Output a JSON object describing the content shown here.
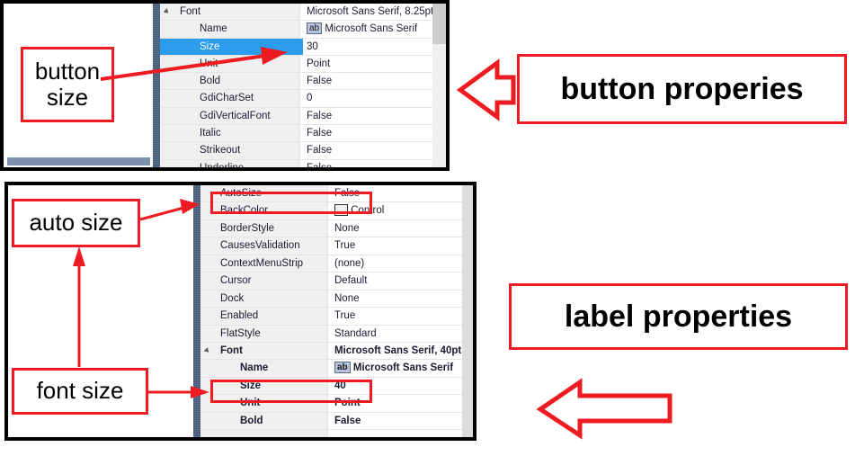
{
  "top_panel": {
    "grid_rows": [
      {
        "name": "Font",
        "value": "Microsoft Sans Serif, 8.25pt",
        "indent": 0,
        "expander": true,
        "selected": false,
        "bold": false,
        "chip": null
      },
      {
        "name": "Name",
        "value": "Microsoft Sans Serif",
        "indent": 1,
        "expander": false,
        "selected": false,
        "bold": false,
        "chip": "ab"
      },
      {
        "name": "Size",
        "value": "30",
        "indent": 1,
        "expander": false,
        "selected": true,
        "bold": false,
        "chip": null
      },
      {
        "name": "Unit",
        "value": "Point",
        "indent": 1,
        "expander": false,
        "selected": false,
        "bold": false,
        "chip": null
      },
      {
        "name": "Bold",
        "value": "False",
        "indent": 1,
        "expander": false,
        "selected": false,
        "bold": false,
        "chip": null
      },
      {
        "name": "GdiCharSet",
        "value": "0",
        "indent": 1,
        "expander": false,
        "selected": false,
        "bold": false,
        "chip": null
      },
      {
        "name": "GdiVerticalFont",
        "value": "False",
        "indent": 1,
        "expander": false,
        "selected": false,
        "bold": false,
        "chip": null
      },
      {
        "name": "Italic",
        "value": "False",
        "indent": 1,
        "expander": false,
        "selected": false,
        "bold": false,
        "chip": null
      },
      {
        "name": "Strikeout",
        "value": "False",
        "indent": 1,
        "expander": false,
        "selected": false,
        "bold": false,
        "chip": null
      },
      {
        "name": "Underline",
        "value": "False",
        "indent": 1,
        "expander": false,
        "selected": false,
        "bold": false,
        "chip": null
      }
    ]
  },
  "bottom_panel": {
    "grid_rows": [
      {
        "name": "AutoSize",
        "value": "False",
        "indent": 0,
        "expander": false,
        "bold": false,
        "chip": null,
        "swatch": false
      },
      {
        "name": "BackColor",
        "value": "Control",
        "indent": 0,
        "expander": false,
        "bold": false,
        "chip": null,
        "swatch": true
      },
      {
        "name": "BorderStyle",
        "value": "None",
        "indent": 0,
        "expander": false,
        "bold": false,
        "chip": null,
        "swatch": false
      },
      {
        "name": "CausesValidation",
        "value": "True",
        "indent": 0,
        "expander": false,
        "bold": false,
        "chip": null,
        "swatch": false
      },
      {
        "name": "ContextMenuStrip",
        "value": "(none)",
        "indent": 0,
        "expander": false,
        "bold": false,
        "chip": null,
        "swatch": false
      },
      {
        "name": "Cursor",
        "value": "Default",
        "indent": 0,
        "expander": false,
        "bold": false,
        "chip": null,
        "swatch": false
      },
      {
        "name": "Dock",
        "value": "None",
        "indent": 0,
        "expander": false,
        "bold": false,
        "chip": null,
        "swatch": false
      },
      {
        "name": "Enabled",
        "value": "True",
        "indent": 0,
        "expander": false,
        "bold": false,
        "chip": null,
        "swatch": false
      },
      {
        "name": "FlatStyle",
        "value": "Standard",
        "indent": 0,
        "expander": false,
        "bold": false,
        "chip": null,
        "swatch": false
      },
      {
        "name": "Font",
        "value": "Microsoft Sans Serif, 40pt",
        "indent": 0,
        "expander": true,
        "bold": true,
        "chip": null,
        "swatch": false
      },
      {
        "name": "Name",
        "value": "Microsoft Sans Serif",
        "indent": 1,
        "expander": false,
        "bold": true,
        "chip": "ab",
        "swatch": false
      },
      {
        "name": "Size",
        "value": "40",
        "indent": 1,
        "expander": false,
        "bold": true,
        "chip": null,
        "swatch": false
      },
      {
        "name": "Unit",
        "value": "Point",
        "indent": 1,
        "expander": false,
        "bold": true,
        "chip": null,
        "swatch": false
      },
      {
        "name": "Bold",
        "value": "False",
        "indent": 1,
        "expander": false,
        "bold": true,
        "chip": null,
        "swatch": false
      }
    ]
  },
  "annotations": {
    "button_size": "button\nsize",
    "button_size_line1": "button",
    "button_size_line2": "size",
    "auto_size": "auto size",
    "font_size": "font size",
    "button_properties": "button properies",
    "label_properties": "label properties"
  },
  "colors": {
    "annotation_red": "#ee1c22",
    "selection_blue": "#2c9ced",
    "splitter": "#4a5f7a",
    "grid_background": "#f0f0f0"
  }
}
